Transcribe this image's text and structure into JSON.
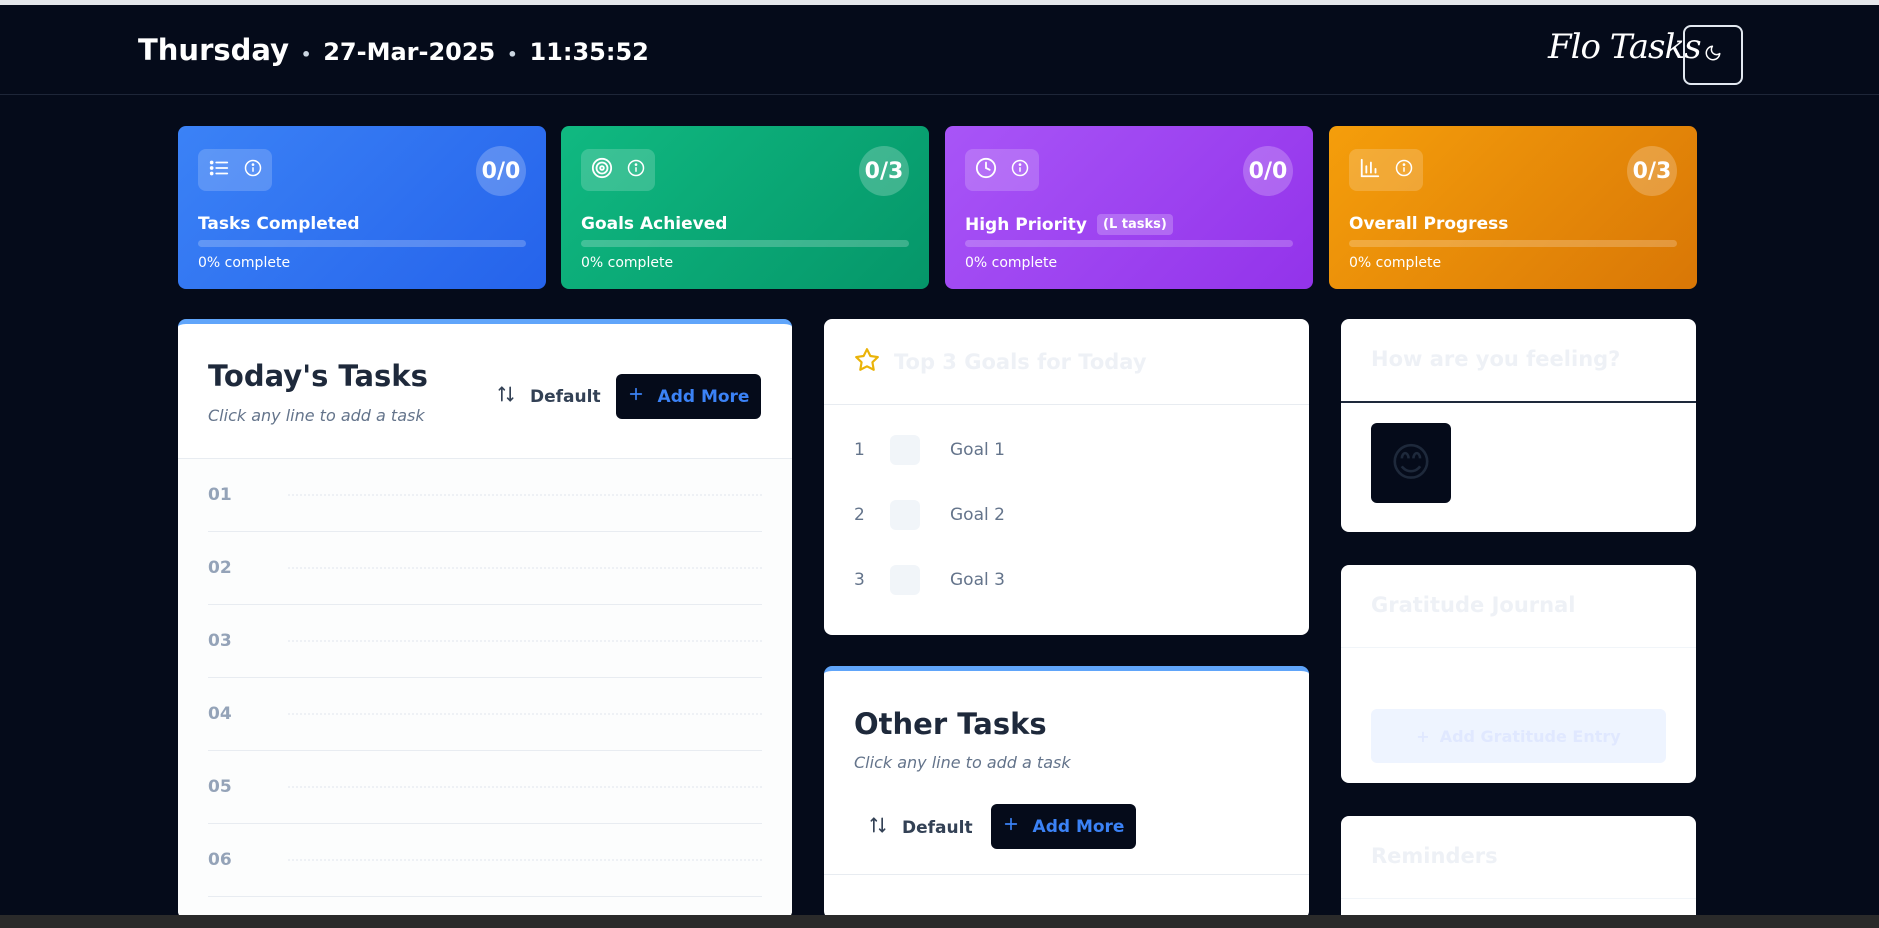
{
  "header": {
    "day": "Thursday",
    "date": "27-Mar-2025",
    "time": "11:35:52",
    "brand": "Flo Tasks",
    "theme_icon": "moon-icon"
  },
  "stats": [
    {
      "title": "Tasks Completed",
      "count": "0/0",
      "sub": "0% complete",
      "progress": 0,
      "icon": "list-icon",
      "color_from": "#3b82f6",
      "color_to": "#2563eb"
    },
    {
      "title": "Goals Achieved",
      "count": "0/3",
      "sub": "0% complete",
      "progress": 0,
      "icon": "target-icon",
      "color_from": "#10b981",
      "color_to": "#059669"
    },
    {
      "title": "High Priority",
      "tag": "(L tasks)",
      "count": "0/0",
      "sub": "0% complete",
      "progress": 0,
      "icon": "clock-icon",
      "color_from": "#a855f7",
      "color_to": "#9333ea"
    },
    {
      "title": "Overall Progress",
      "count": "0/3",
      "sub": "0% complete",
      "progress": 0,
      "icon": "bar-chart-icon",
      "color_from": "#f59e0b",
      "color_to": "#d97706"
    }
  ],
  "today_tasks": {
    "title": "Today's Tasks",
    "subtitle": "Click any line to add a task",
    "sort_label": "Default",
    "add_label": "Add More",
    "rows": [
      "01",
      "02",
      "03",
      "04",
      "05",
      "06"
    ]
  },
  "top_goals": {
    "title": "Top 3 Goals for Today",
    "goals": [
      {
        "num": "1",
        "label": "Goal 1"
      },
      {
        "num": "2",
        "label": "Goal 2"
      },
      {
        "num": "3",
        "label": "Goal 3"
      }
    ]
  },
  "other_tasks": {
    "title": "Other Tasks",
    "subtitle": "Click any line to add a task",
    "sort_label": "Default",
    "add_label": "Add More"
  },
  "feeling": {
    "title": "How are you feeling?",
    "emoji": "😊"
  },
  "gratitude": {
    "title": "Gratitude Journal",
    "add_label": "Add Gratitude Entry"
  },
  "reminders": {
    "title": "Reminders"
  }
}
